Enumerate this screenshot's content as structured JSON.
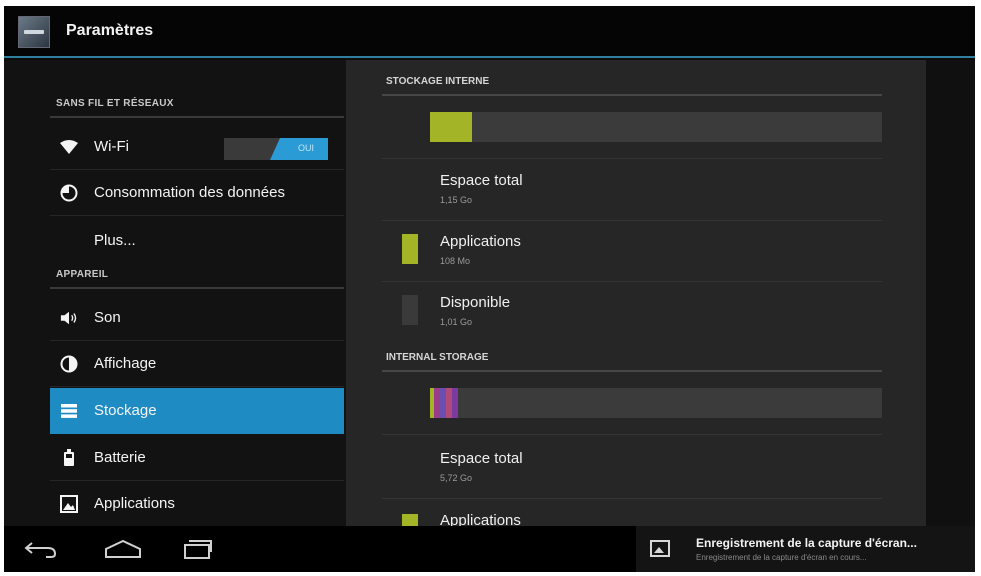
{
  "action_bar": {
    "title": "Paramètres",
    "icon": "settings-app-icon"
  },
  "left": {
    "section_wireless": "SANS FIL ET RÉSEAUX",
    "section_device": "APPAREIL",
    "wifi": {
      "label": "Wi-Fi",
      "icon": "wifi-icon",
      "toggle_label": "OUI",
      "toggle_state": "on"
    },
    "data_usage": {
      "label": "Consommation des données",
      "icon": "data-usage-icon"
    },
    "more": {
      "label": "Plus..."
    },
    "sound": {
      "label": "Son",
      "icon": "speaker-icon"
    },
    "display": {
      "label": "Affichage",
      "icon": "brightness-icon"
    },
    "storage": {
      "label": "Stockage",
      "icon": "storage-icon",
      "selected": true
    },
    "battery": {
      "label": "Batterie",
      "icon": "battery-icon"
    },
    "apps": {
      "label": "Applications",
      "icon": "apps-icon"
    }
  },
  "right": {
    "internal": {
      "header": "STOCKAGE INTERNE",
      "usage_fraction": 0.092,
      "total_label": "Espace total",
      "total_value": "1,15 Go",
      "apps_label": "Applications",
      "apps_value": "108 Mo",
      "free_label": "Disponible",
      "free_value": "1,01 Go"
    },
    "storage2": {
      "header": "INTERNAL STORAGE",
      "total_label": "Espace total",
      "total_value": "5,72 Go",
      "apps_label": "Applications"
    },
    "colors": {
      "apps": "#a3b526",
      "free": "#3a3a3a",
      "bar_bg": "#3b3b3b",
      "accent": "#1e8bc3"
    }
  },
  "nav": {
    "back_icon": "back-icon",
    "home_icon": "home-icon",
    "recents_icon": "recent-apps-icon",
    "notification": {
      "icon": "image-icon",
      "title": "Enregistrement de la capture d'écran...",
      "subtitle": "Enregistrement de la capture d'écran en cours..."
    }
  }
}
